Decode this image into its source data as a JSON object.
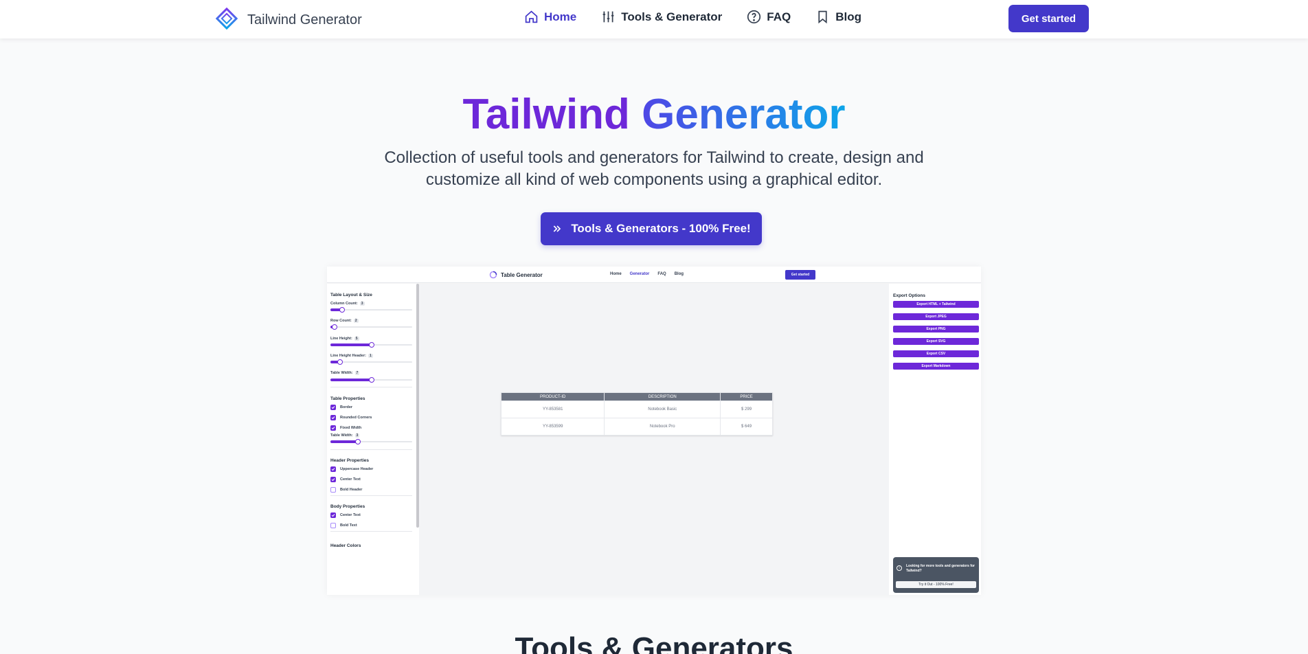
{
  "nav": {
    "brand": "Tailwind Generator",
    "links": [
      {
        "label": "Home",
        "icon": "home-icon",
        "active": true
      },
      {
        "label": "Tools & Generator",
        "icon": "sliders-icon",
        "active": false
      },
      {
        "label": "FAQ",
        "icon": "question-icon",
        "active": false
      },
      {
        "label": "Blog",
        "icon": "bookmark-icon",
        "active": false
      }
    ],
    "cta": "Get started"
  },
  "hero": {
    "title_part1": "Tailwind",
    "title_part2": "Generator",
    "subtitle": "Collection of useful tools and generators for Tailwind to create, design and customize all kind of web components using a graphical editor.",
    "cta": "Tools & Generators - 100% Free!"
  },
  "preview": {
    "nav": {
      "brand": "Table Generator",
      "links": [
        "Home",
        "Generator",
        "FAQ",
        "Blog"
      ],
      "cta": "Get started"
    },
    "left": {
      "layout_title": "Table Layout & Size",
      "sliders": [
        {
          "label": "Column Count:",
          "value": "3",
          "fraction": 0.14
        },
        {
          "label": "Row Count:",
          "value": "2",
          "fraction": 0.05
        },
        {
          "label": "Line Height:",
          "value": "5",
          "fraction": 0.5
        },
        {
          "label": "Line Height Header:",
          "value": "1",
          "fraction": 0.12
        },
        {
          "label": "Table Width:",
          "value": "7",
          "fraction": 0.5
        }
      ],
      "props_title": "Table Properties",
      "props": [
        {
          "label": "Border",
          "checked": true
        },
        {
          "label": "Rounded Corners",
          "checked": true
        },
        {
          "label": "Fixed Width",
          "checked": true
        }
      ],
      "props_slider": {
        "label": "Table Width:",
        "value": "3",
        "fraction": 0.34
      },
      "header_title": "Header Properties",
      "header_props": [
        {
          "label": "Uppercase Header",
          "checked": true
        },
        {
          "label": "Center Text",
          "checked": true
        },
        {
          "label": "Bold Header",
          "checked": false
        }
      ],
      "body_title": "Body Properties",
      "body_props": [
        {
          "label": "Center Text",
          "checked": true
        },
        {
          "label": "Bold Text",
          "checked": false
        }
      ],
      "colors_title": "Header Colors"
    },
    "table": {
      "headers": [
        "PRODUCT-ID",
        "DESCRIPTION",
        "PRICE"
      ],
      "rows": [
        [
          "YY-853581",
          "Notebook Basic",
          "$ 299"
        ],
        [
          "YY-853599",
          "Notebook Pro",
          "$ 649"
        ]
      ]
    },
    "right": {
      "title": "Export Options",
      "buttons": [
        "Export HTML + Tailwind",
        "Export JPEG",
        "Export PNG",
        "Export SVG",
        "Export CSV",
        "Export Markdown"
      ],
      "promo_text": "Looking for more tools and generators for Tailwind?",
      "promo_button": "Try it Out - 100% Free!"
    }
  },
  "section_heading": "Tools & Generators",
  "colors": {
    "primary": "#4338ca",
    "violet": "#6d28d9",
    "sky": "#0ea5e9"
  }
}
